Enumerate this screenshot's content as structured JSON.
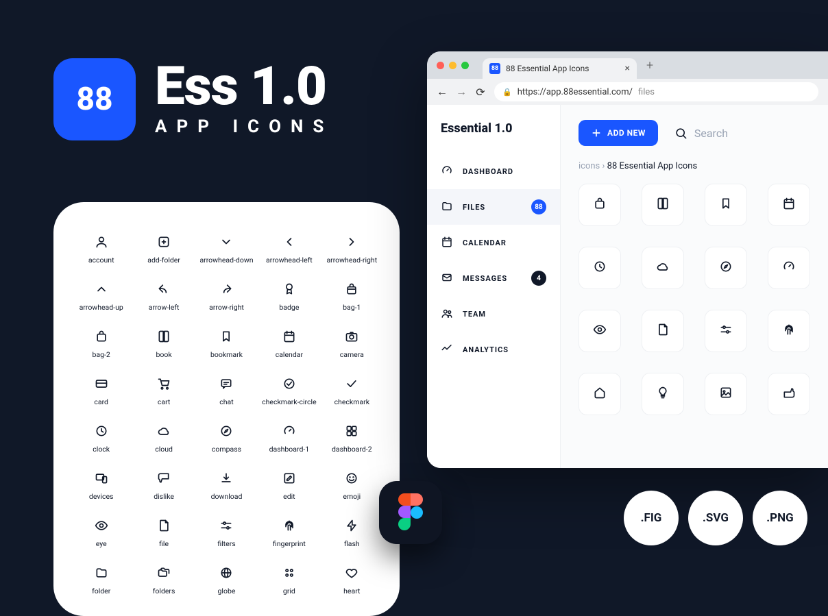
{
  "brand": {
    "badge": "88",
    "title": "Ess 1.0",
    "subtitle": "APP ICONS"
  },
  "icon_list": [
    "account",
    "add-folder",
    "arrowhead-down",
    "arrowhead-left",
    "arrowhead-right",
    "arrowhead-up",
    "arrow-left",
    "arrow-right",
    "badge",
    "bag-1",
    "bag-2",
    "book",
    "bookmark",
    "calendar",
    "camera",
    "card",
    "cart",
    "chat",
    "checkmark-circle",
    "checkmark",
    "clock",
    "cloud",
    "compass",
    "dashboard-1",
    "dashboard-2",
    "devices",
    "dislike",
    "download",
    "edit",
    "emoji",
    "eye",
    "file",
    "filters",
    "fingerprint",
    "flash",
    "folder",
    "folders",
    "globe",
    "grid",
    "heart"
  ],
  "browser": {
    "tab_title": "88 Essential App Icons",
    "url_host": "https://app.88essential.com/",
    "url_path": "files"
  },
  "sidebar": {
    "title": "Essential 1.0",
    "items": [
      {
        "label": "DASHBOARD",
        "icon": "dashboard",
        "badge": null,
        "active": false
      },
      {
        "label": "FILES",
        "icon": "folder",
        "badge": "88",
        "badge_color": "blue",
        "active": true
      },
      {
        "label": "CALENDAR",
        "icon": "calendar",
        "badge": null,
        "active": false
      },
      {
        "label": "MESSAGES",
        "icon": "mail",
        "badge": "4",
        "badge_color": "dark",
        "active": false
      },
      {
        "label": "TEAM",
        "icon": "team",
        "badge": null,
        "active": false
      },
      {
        "label": "ANALYTICS",
        "icon": "analytics",
        "badge": null,
        "active": false
      }
    ]
  },
  "main": {
    "add_new": "ADD NEW",
    "search_placeholder": "Search",
    "breadcrumb_root": "icons",
    "breadcrumb_sep": " › ",
    "breadcrumb_current": "88 Essential App Icons",
    "tiles": [
      "bag",
      "book",
      "bookmark",
      "calendar",
      "clock",
      "cloud",
      "compass",
      "dashboard",
      "eye",
      "file",
      "filters",
      "fingerprint",
      "home",
      "idea",
      "image",
      "like"
    ]
  },
  "formats": [
    ".FIG",
    ".SVG",
    ".PNG"
  ]
}
